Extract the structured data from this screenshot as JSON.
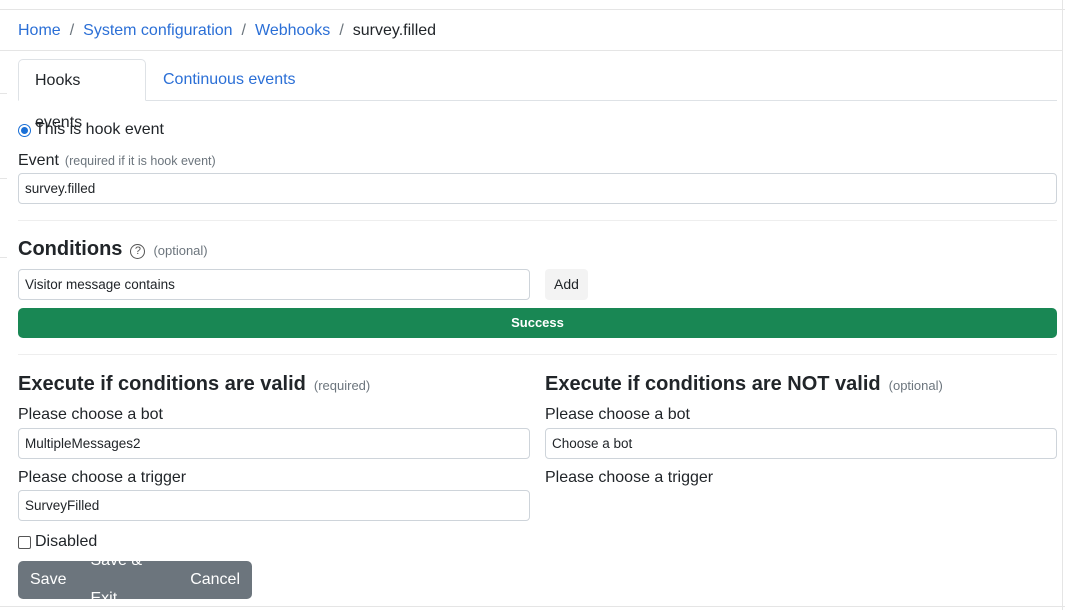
{
  "breadcrumb": {
    "home": "Home",
    "system": "System configuration",
    "webhooks": "Webhooks",
    "current": "survey.filled",
    "separator": "/"
  },
  "tabs": {
    "hooks": "Hooks events",
    "continuous": "Continuous events"
  },
  "hook_radio": {
    "label": "This is hook event",
    "checked": true
  },
  "event": {
    "label": "Event",
    "hint": "(required if it is hook event)",
    "value": "survey.filled"
  },
  "conditions": {
    "title": "Conditions",
    "help_icon": "?",
    "hint": "(optional)",
    "select_value": "Visitor message contains",
    "add_label": "Add",
    "status": "Success"
  },
  "valid": {
    "title": "Execute if conditions are valid",
    "hint": "(required)",
    "bot_label": "Please choose a bot",
    "bot_value": "MultipleMessages2",
    "trigger_label": "Please choose a trigger",
    "trigger_value": "SurveyFilled"
  },
  "invalid": {
    "title": "Execute if conditions are NOT valid",
    "hint": "(optional)",
    "bot_label": "Please choose a bot",
    "bot_value": "Choose a bot",
    "trigger_label": "Please choose a trigger"
  },
  "disabled": {
    "label": "Disabled",
    "checked": false
  },
  "actions": {
    "save": "Save",
    "save_exit": "Save & Exit",
    "cancel": "Cancel"
  },
  "colors": {
    "link": "#2b6fd6",
    "success": "#198754",
    "button_secondary": "#6c757d"
  }
}
